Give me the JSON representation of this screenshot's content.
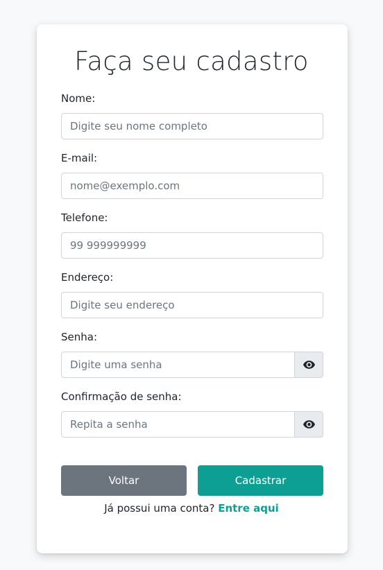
{
  "form": {
    "title": "Faça seu cadastro",
    "fields": {
      "name": {
        "label": "Nome:",
        "placeholder": "Digite seu nome completo"
      },
      "email": {
        "label": "E-mail:",
        "placeholder": "nome@exemplo.com"
      },
      "phone": {
        "label": "Telefone:",
        "placeholder": "99 999999999"
      },
      "address": {
        "label": "Endereço:",
        "placeholder": "Digite seu endereço"
      },
      "password": {
        "label": "Senha:",
        "placeholder": "Digite uma senha",
        "toggle_icon": "eye-icon"
      },
      "password_confirm": {
        "label": "Confirmação de senha:",
        "placeholder": "Repita a senha",
        "toggle_icon": "eye-icon"
      }
    },
    "buttons": {
      "back": "Voltar",
      "submit": "Cadastrar"
    },
    "footer": {
      "text": "Já possui uma conta?",
      "link": "Entre aqui"
    }
  },
  "colors": {
    "accent": "#0d9e94",
    "secondary": "#6c757d",
    "background": "#f8f9fa"
  }
}
